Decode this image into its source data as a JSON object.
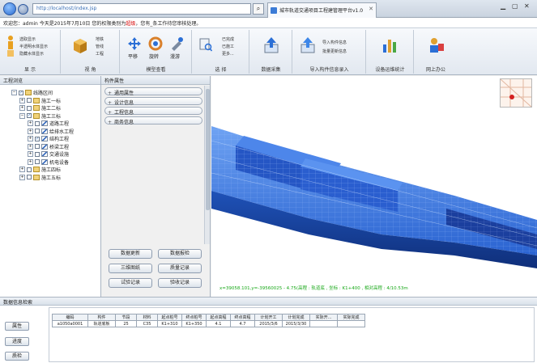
{
  "browser": {
    "url": "http://localhost/index.jsp",
    "tab_title": "城市轨道交通项目工程建管理平台v1.0",
    "search_glyph": "⌕"
  },
  "welcome": {
    "prefix": "欢迎您：admin  今天是2015年7月10日  您的权限类别为",
    "highlight": "超级",
    "suffix": "，您有_条工作待您审核处理。"
  },
  "ribbon": {
    "groups": [
      {
        "label": "显 示",
        "small_items": [
          "选取显示",
          "半透明水体显示",
          "隐藏水体显示"
        ]
      },
      {
        "label": "视 角",
        "small_items": [
          "地铁",
          "管线",
          "工程"
        ]
      },
      {
        "label": "模型查看",
        "buttons": [
          "平移",
          "旋转",
          "漫游"
        ]
      },
      {
        "label": "选 择",
        "small_items": [
          "已完成",
          "已施工",
          "更多..."
        ]
      },
      {
        "label": "数据采集",
        "buttons": [
          ""
        ]
      },
      {
        "label": "导入构件信息录入",
        "small_items": [
          "导入构件信息",
          "批量更新信息"
        ]
      },
      {
        "label": "设备运维统计",
        "buttons": [
          ""
        ]
      },
      {
        "label": "网上办公",
        "buttons": [
          ""
        ]
      }
    ]
  },
  "tree": {
    "title": "工程浏览",
    "nodes": [
      {
        "label": "线路区间",
        "level": 0,
        "checked": true,
        "expanded": true,
        "icon": "folder"
      },
      {
        "label": "施工一标",
        "level": 1,
        "checked": false,
        "expanded": false,
        "icon": "folder"
      },
      {
        "label": "施工二标",
        "level": 1,
        "checked": false,
        "expanded": false,
        "icon": "folder"
      },
      {
        "label": "施工三标",
        "level": 1,
        "checked": true,
        "expanded": true,
        "icon": "folder"
      },
      {
        "label": "道路工程",
        "level": 2,
        "checked": false,
        "expanded": false,
        "icon": "pencil"
      },
      {
        "label": "给排水工程",
        "level": 2,
        "checked": false,
        "expanded": false,
        "icon": "pencil"
      },
      {
        "label": "结构工程",
        "level": 2,
        "checked": true,
        "expanded": false,
        "icon": "pencil"
      },
      {
        "label": "桥梁工程",
        "level": 2,
        "checked": false,
        "expanded": false,
        "icon": "pencil"
      },
      {
        "label": "交通设施",
        "level": 2,
        "checked": false,
        "expanded": false,
        "icon": "pencil"
      },
      {
        "label": "机电设备",
        "level": 2,
        "checked": false,
        "expanded": false,
        "icon": "pencil"
      },
      {
        "label": "施工四标",
        "level": 1,
        "checked": false,
        "expanded": false,
        "icon": "folder"
      },
      {
        "label": "施工五标",
        "level": 1,
        "checked": false,
        "expanded": false,
        "icon": "folder"
      }
    ]
  },
  "attributes": {
    "title": "构件属性",
    "items": [
      "通用属性",
      "设计信息",
      "工程信息",
      "商务信息"
    ],
    "buttons": [
      "数据更新",
      "数据报检",
      "三维图纸",
      "质量记录",
      "试验记录",
      "验收记录"
    ]
  },
  "viewport": {
    "coord_text": "x=39058.101,y=-39560025 - 4.75(高程 : 轨道底 , 坐标 : K1+400 , 相对高程 : 4/10.53m"
  },
  "bottom": {
    "title": "数据信息检索",
    "side_buttons": [
      "属性",
      "进度",
      "质检"
    ],
    "columns": [
      "编码",
      "构件",
      "节段",
      "材料",
      "起点桩号",
      "终点桩号",
      "起点高程",
      "终点高程",
      "计划开工",
      "计划完成",
      "实际开...",
      "实际完成"
    ],
    "rows": [
      [
        "a1050a0001",
        "轨道底板",
        "25",
        "C35",
        "K1+310",
        "K1+350",
        "4.1",
        "4.7",
        "2015/3/6",
        "2015/3/30",
        "",
        ""
      ]
    ]
  },
  "colors": {
    "model_blue": "#2f6fe0",
    "coord_green": "#18a818",
    "welcome_highlight": "#d40000"
  }
}
